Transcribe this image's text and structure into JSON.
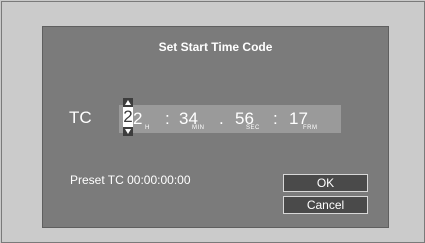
{
  "dialog": {
    "title": "Set Start Time Code",
    "tc_label": "TC",
    "timecode": {
      "hours_tens": "2",
      "hours_units": "2",
      "hours_unit": "H",
      "sep1": ":",
      "minutes": "34",
      "minutes_unit": "MIN",
      "sep2": ".",
      "seconds": "56",
      "seconds_unit": "SEC",
      "sep3": ":",
      "frames": "17",
      "frames_unit": "FRM"
    },
    "preset": "Preset TC 00:00:00:00",
    "buttons": {
      "ok": "OK",
      "cancel": "Cancel"
    }
  }
}
